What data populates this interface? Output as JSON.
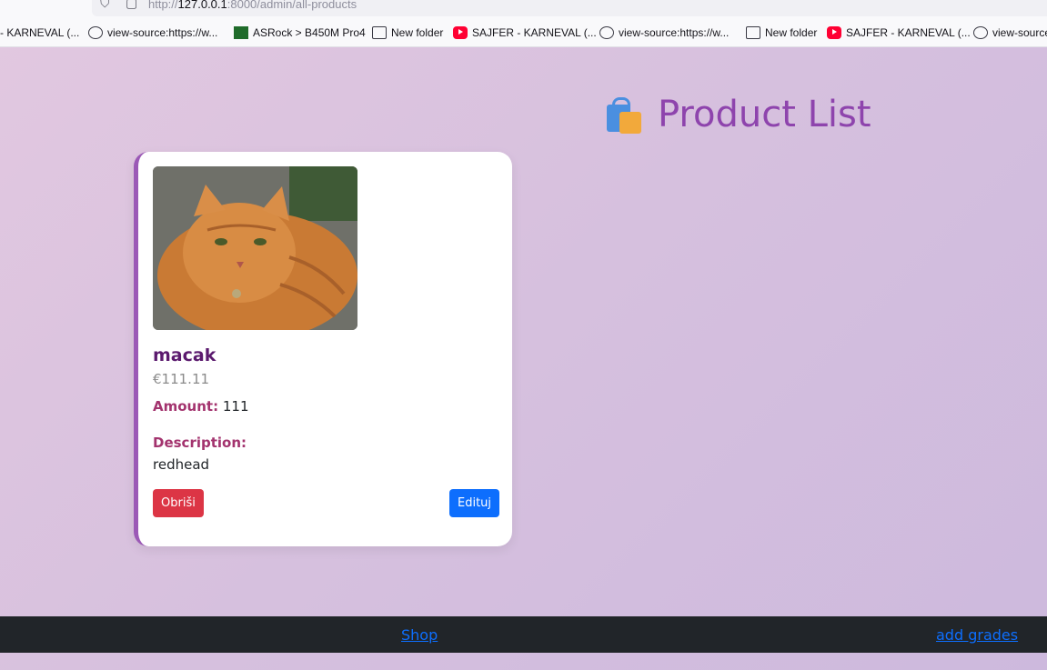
{
  "browser": {
    "url_prefix": "http://",
    "url_host": "127.0.0.1",
    "url_rest": ":8000/admin/all-products",
    "bookmarks": [
      {
        "label": "- KARNEVAL (...",
        "icon": "none"
      },
      {
        "label": "view-source:https://w...",
        "icon": "globe-icon"
      },
      {
        "label": "ASRock > B450M Pro4",
        "icon": "asrock-icon"
      },
      {
        "label": "New folder",
        "icon": "folder-icon"
      },
      {
        "label": "SAJFER - KARNEVAL (...",
        "icon": "youtube-icon"
      },
      {
        "label": "view-source:https://w...",
        "icon": "globe-icon"
      },
      {
        "label": "New folder",
        "icon": "folder-icon"
      },
      {
        "label": "SAJFER - KARNEVAL (...",
        "icon": "youtube-icon"
      },
      {
        "label": "view-source",
        "icon": "globe-icon"
      }
    ]
  },
  "page": {
    "title": "Product List",
    "title_icon": "shopping-bags-icon"
  },
  "product": {
    "name": "macak",
    "price": "€111.11",
    "amount_label": "Amount:",
    "amount": "111",
    "description_label": "Description:",
    "description": "redhead",
    "image": "cat-photo",
    "delete_label": "Obriši",
    "edit_label": "Edituj"
  },
  "footer": {
    "shop_label": "Shop",
    "grades_label": "add grades"
  },
  "colors": {
    "title": "#8e44ad",
    "card_accent": "#9b59b6",
    "delete": "#dc3545",
    "edit": "#0d6efd",
    "footer_bg": "#212529"
  }
}
